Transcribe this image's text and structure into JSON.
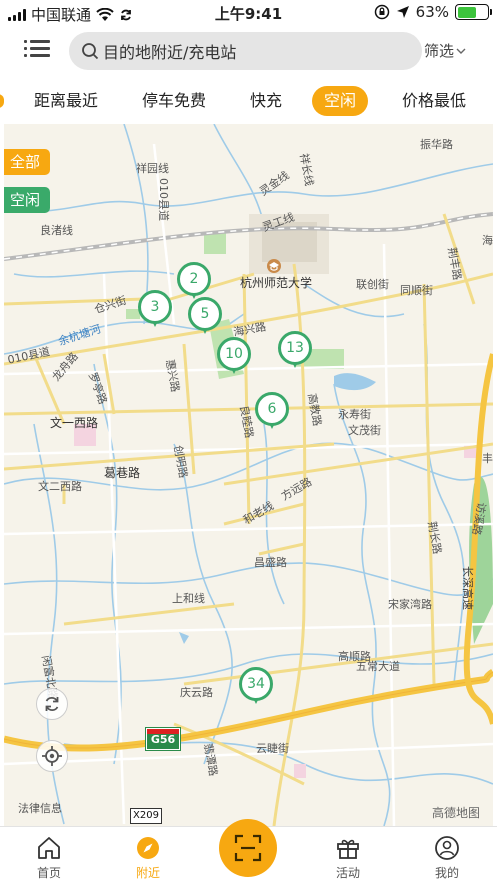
{
  "status_bar": {
    "carrier": "中国联通",
    "time": "上午9:41",
    "battery_percent": "63%",
    "battery_level": 0.63
  },
  "header": {
    "search_placeholder": "目的地附近/充电站",
    "filter_label": "筛选"
  },
  "tabs": [
    {
      "label": "距离最近",
      "active": false
    },
    {
      "label": "停车免费",
      "active": false
    },
    {
      "label": "快充",
      "active": false
    },
    {
      "label": "空闲",
      "active": true
    },
    {
      "label": "价格最低",
      "active": false
    }
  ],
  "map": {
    "chips": {
      "all": "全部",
      "idle": "空闲"
    },
    "pins": [
      "2",
      "3",
      "5",
      "10",
      "13",
      "6",
      "34"
    ],
    "labels": {
      "xiangyuan": "祥园线",
      "xiangchang": "祥长线",
      "zhenhua": "振华路",
      "liangzhu": "良渚线",
      "lingjin": "灵金线",
      "linggong": "灵工线",
      "hz_normal_univ": "杭州师范大学",
      "lianchuang": "联创街",
      "tongshun": "同顺街",
      "cangxing": "仓兴街",
      "road010": "010县道",
      "road010b": "010县道",
      "yuhang_canal": "余杭塘河",
      "longzhou": "龙舟路",
      "luoting": "罗亭路",
      "huixing": "惠兴路",
      "haixing": "海兴路",
      "gaojiao": "高教路",
      "yongshou": "永寿街",
      "wenmao": "文茂街",
      "wenyi_west": "文一西路",
      "liangmu": "良睦路",
      "geheng": "葛巷路",
      "chuangming": "创明路",
      "wener_west": "文二西路",
      "helao": "和老线",
      "fangyuan": "方远路",
      "changsheng": "昌盛路",
      "jingchang": "荆长路",
      "songjiawan": "宋家湾路",
      "changxiang": "长深高速",
      "fangjiang": "访溪路",
      "shanghe": "上和线",
      "gaoshun": "高顺路",
      "wuchang": "五常大道",
      "xianbei": "闲富北路",
      "qingyun": "庆云路",
      "yunti": "云睫街",
      "jingtan": "翡潭路",
      "lishui": "荆丰路",
      "hai": "海",
      "fenghe": "丰",
      "legal": "法律信息",
      "amap": "高德地图",
      "g56": "G56",
      "x209": "X209"
    }
  },
  "bottom_nav": {
    "home": "首页",
    "nearby": "附近",
    "activity": "活动",
    "mine": "我的"
  },
  "colors": {
    "accent": "#f7a811",
    "pin_green": "#3aa86a",
    "search_bg": "#e5e5e5"
  }
}
